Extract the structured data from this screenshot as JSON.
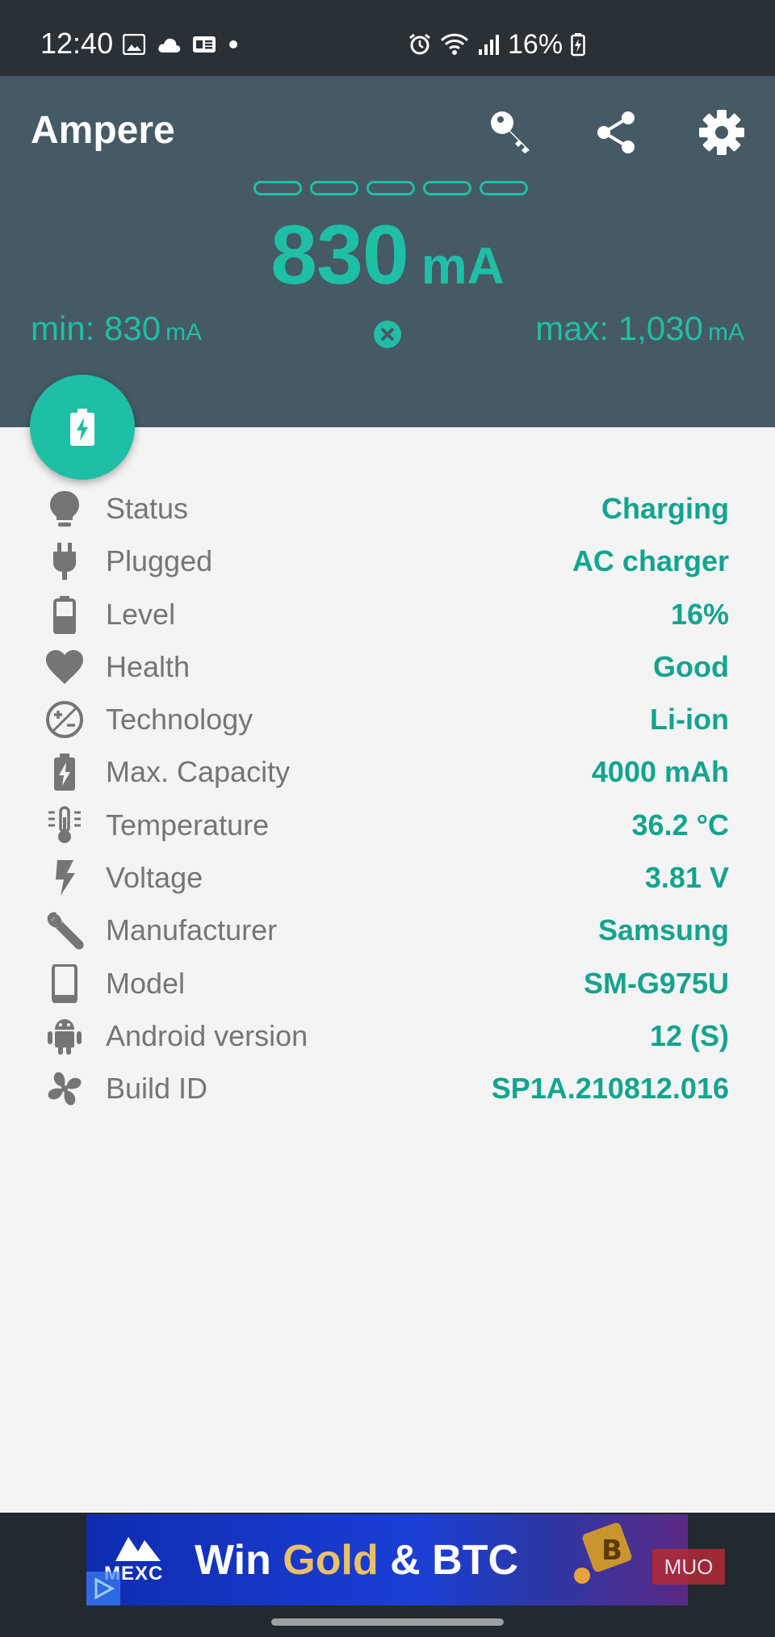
{
  "status_bar": {
    "time": "12:40",
    "left_icons": [
      "image-icon",
      "cloud-icon",
      "news-icon",
      "dot-icon"
    ],
    "right_icons": [
      "alarm-icon",
      "wifi-icon",
      "signal-icon"
    ],
    "battery_percent": "16%"
  },
  "app": {
    "title": "Ampere",
    "actions": [
      "key-icon",
      "share-icon",
      "settings-icon"
    ]
  },
  "meter": {
    "value": "830",
    "unit": "mA",
    "min_label": "min: 830",
    "max_label": "max: 1,030",
    "min_unit": "mA",
    "max_unit": "mA",
    "accent_color": "#1fbfa5"
  },
  "info": [
    {
      "icon": "bulb-icon",
      "label": "Status",
      "value": "Charging"
    },
    {
      "icon": "plug-icon",
      "label": "Plugged",
      "value": "AC charger"
    },
    {
      "icon": "battery-icon",
      "label": "Level",
      "value": "16%"
    },
    {
      "icon": "heart-icon",
      "label": "Health",
      "value": "Good"
    },
    {
      "icon": "technology-icon",
      "label": "Technology",
      "value": "Li-ion"
    },
    {
      "icon": "battery-charging-icon",
      "label": "Max. Capacity",
      "value": "4000 mAh"
    },
    {
      "icon": "thermometer-icon",
      "label": "Temperature",
      "value": "36.2 °C"
    },
    {
      "icon": "bolt-icon",
      "label": "Voltage",
      "value": "3.81 V"
    },
    {
      "icon": "wrench-icon",
      "label": "Manufacturer",
      "value": "Samsung"
    },
    {
      "icon": "phone-icon",
      "label": "Model",
      "value": "SM-G975U"
    },
    {
      "icon": "android-icon",
      "label": "Android version",
      "value": "12 (S)"
    },
    {
      "icon": "fan-icon",
      "label": "Build ID",
      "value": "SP1A.210812.016"
    }
  ],
  "ad": {
    "brand": "MEXC",
    "text_a": "Win ",
    "text_b": "Gold",
    "text_c": " & BTC",
    "watermark": "MUO"
  }
}
